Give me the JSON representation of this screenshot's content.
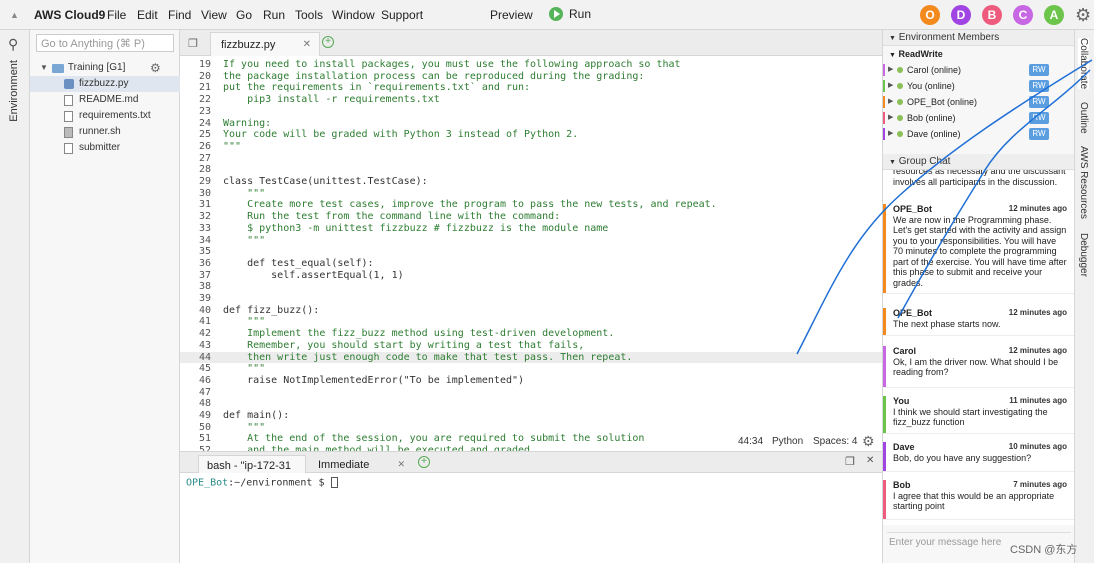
{
  "menubar": {
    "brand": "AWS Cloud9",
    "menus": [
      "File",
      "Edit",
      "Find",
      "View",
      "Go",
      "Run",
      "Tools",
      "Window",
      "Support"
    ],
    "preview": "Preview",
    "run": "Run",
    "avatars": [
      {
        "letter": "O",
        "color": "#f4891e"
      },
      {
        "letter": "D",
        "color": "#a144e4"
      },
      {
        "letter": "B",
        "color": "#ef5b7c"
      },
      {
        "letter": "C",
        "color": "#c767e3"
      },
      {
        "letter": "A",
        "color": "#6cc44a"
      }
    ]
  },
  "left_strip": {
    "label": "Environment"
  },
  "file_panel": {
    "goto_placeholder": "Go to Anything (⌘ P)",
    "root": "Training [G1]",
    "files": [
      "fizzbuzz.py",
      "README.md",
      "requirements.txt",
      "runner.sh",
      "submitter"
    ]
  },
  "editor_tab": {
    "name": "fizzbuzz.py"
  },
  "editor": {
    "lines": [
      {
        "n": "19",
        "t": "If you need to install packages, you must use the following approach so that",
        "k": "g"
      },
      {
        "n": "20",
        "t": "the package installation process can be reproduced during the grading:",
        "k": "g"
      },
      {
        "n": "21",
        "t": "put the requirements in `requirements.txt` and run:",
        "k": "g"
      },
      {
        "n": "22",
        "t": "    pip3 install -r requirements.txt",
        "k": "g"
      },
      {
        "n": "23",
        "t": "",
        "k": "g"
      },
      {
        "n": "24",
        "t": "Warning:",
        "k": "g"
      },
      {
        "n": "25",
        "t": "Your code will be graded with Python 3 instead of Python 2.",
        "k": "g"
      },
      {
        "n": "26",
        "t": "\"\"\"",
        "k": "g"
      },
      {
        "n": "27",
        "t": "",
        "k": "g"
      },
      {
        "n": "28",
        "t": "",
        "k": "g"
      },
      {
        "n": "29",
        "t": "class TestCase(unittest.TestCase):",
        "k": "c"
      },
      {
        "n": "30",
        "t": "    \"\"\"",
        "k": "g"
      },
      {
        "n": "31",
        "t": "    Create more test cases, improve the program to pass the new tests, and repeat.",
        "k": "g"
      },
      {
        "n": "32",
        "t": "    Run the test from the command line with the command:",
        "k": "g"
      },
      {
        "n": "33",
        "t": "    $ python3 -m unittest fizzbuzz # fizzbuzz is the module name",
        "k": "g"
      },
      {
        "n": "34",
        "t": "    \"\"\"",
        "k": "g"
      },
      {
        "n": "35",
        "t": "",
        "k": "g"
      },
      {
        "n": "36",
        "t": "    def test_equal(self):",
        "k": "c"
      },
      {
        "n": "37",
        "t": "        self.assertEqual(1, 1)",
        "k": "c"
      },
      {
        "n": "38",
        "t": "",
        "k": "g"
      },
      {
        "n": "39",
        "t": "",
        "k": "g"
      },
      {
        "n": "40",
        "t": "def fizz_buzz():",
        "k": "c"
      },
      {
        "n": "41",
        "t": "    \"\"\"",
        "k": "g"
      },
      {
        "n": "42",
        "t": "    Implement the fizz_buzz method using test-driven development.",
        "k": "g"
      },
      {
        "n": "43",
        "t": "    Remember, you should start by writing a test that fails,",
        "k": "g"
      },
      {
        "n": "44",
        "t": "    then write just enough code to make that test pass. Then repeat.",
        "k": "g"
      },
      {
        "n": "45",
        "t": "    \"\"\"",
        "k": "g"
      },
      {
        "n": "46",
        "t": "    raise NotImplementedError(\"To be implemented\")",
        "k": "c"
      },
      {
        "n": "47",
        "t": "",
        "k": "g"
      },
      {
        "n": "48",
        "t": "",
        "k": "g"
      },
      {
        "n": "49",
        "t": "def main():",
        "k": "c"
      },
      {
        "n": "50",
        "t": "    \"\"\"",
        "k": "g"
      },
      {
        "n": "51",
        "t": "    At the end of the session, you are required to submit the solution",
        "k": "g"
      },
      {
        "n": "52",
        "t": "    and the main method will be executed and graded",
        "k": "g"
      }
    ]
  },
  "status": {
    "position": "44:34",
    "language": "Python",
    "spaces": "Spaces: 4"
  },
  "terminal": {
    "tabs": [
      "bash - \"ip-172-31",
      "Immediate"
    ],
    "prompt_user": "OPE_Bot",
    "prompt_path": ":~/environment $ "
  },
  "members": {
    "header": "Environment Members",
    "group": "ReadWrite",
    "list": [
      {
        "name": "Carol (online)",
        "color": "#c767e3",
        "rw": "RW"
      },
      {
        "name": "You (online)",
        "color": "#6cc44a",
        "rw": "RW"
      },
      {
        "name": "OPE_Bot (online)",
        "color": "#f4891e",
        "rw": "RW"
      },
      {
        "name": "Bob (online)",
        "color": "#ef5b7c",
        "rw": "RW"
      },
      {
        "name": "Dave (online)",
        "color": "#a144e4",
        "rw": "RW"
      }
    ]
  },
  "chat": {
    "header": "Group Chat",
    "partial": "resources as necessary and the discussant involves all participants in the discussion.",
    "messages": [
      {
        "who": "OPE_Bot",
        "time": "12 minutes ago",
        "text": "We are now in the Programming phase. Let's get started with the activity and assign you to your responsibilities. You will have 70 minutes to complete the programming part of the exercise. You will have time after this phase to submit and receive your grades.",
        "color": "#f4891e"
      },
      {
        "who": "OPE_Bot",
        "time": "12 minutes ago",
        "text": "The next phase starts now.",
        "color": "#f4891e"
      },
      {
        "who": "Carol",
        "time": "12 minutes ago",
        "text": "Ok, I am the driver now. What should I be reading from?",
        "color": "#c767e3"
      },
      {
        "who": "You",
        "time": "11 minutes ago",
        "text": "I think we should start investigating the fizz_buzz function",
        "color": "#6cc44a"
      },
      {
        "who": "Dave",
        "time": "10 minutes ago",
        "text": "Bob, do you have any suggestion?",
        "color": "#a144e4"
      },
      {
        "who": "Bob",
        "time": "7 minutes ago",
        "text": "I agree that this would be an appropriate starting point",
        "color": "#ef5b7c"
      }
    ],
    "input_placeholder": "Enter your message here"
  },
  "right_strip": [
    "Collaborate",
    "Outline",
    "AWS Resources",
    "Debugger"
  ],
  "watermark": "CSDN @东方"
}
